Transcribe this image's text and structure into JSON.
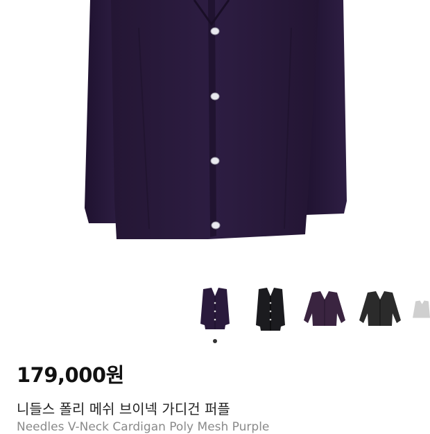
{
  "product": {
    "price": "179,000원",
    "title_ko": "니들스 폴리 메쉬 브이넥 가디건 퍼플",
    "title_en": "Needles V-Neck Cardigan Poly Mesh Purple"
  },
  "gallery": {
    "thumbnails": [
      {
        "label": "purple-front",
        "color": "#2a1a3c"
      },
      {
        "label": "black-front",
        "color": "#1b1b1f"
      },
      {
        "label": "purple-mesh-flat",
        "color": "#3a2440"
      },
      {
        "label": "charcoal-flat",
        "color": "#2b2b2b"
      },
      {
        "label": "grey-flat",
        "color": "#cfcfcf"
      }
    ]
  },
  "colors": {
    "garment": "#2a1b3d",
    "garment_dark": "#1e1230",
    "button": "#e8e8ee"
  }
}
